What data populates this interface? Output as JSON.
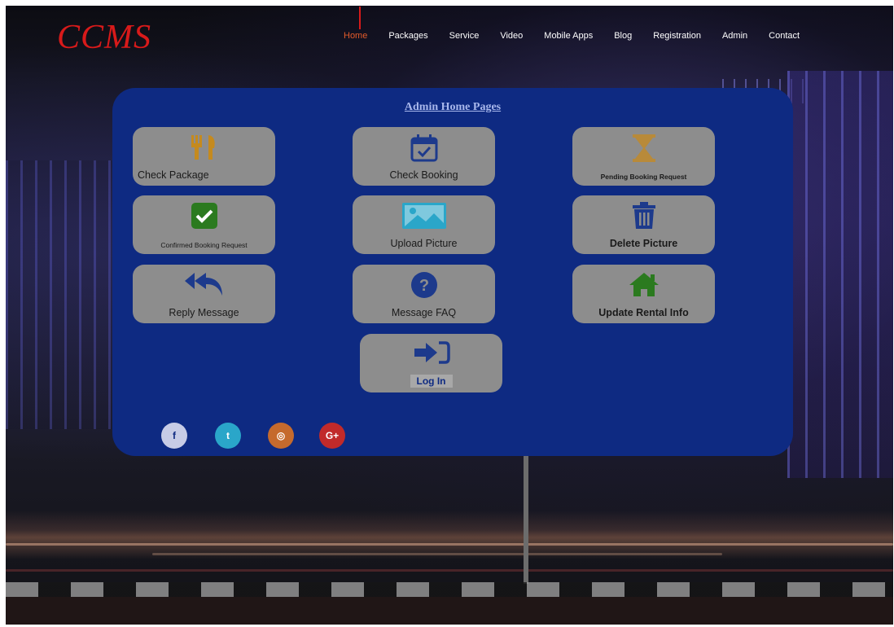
{
  "header": {
    "logo": "CCMS",
    "nav": [
      "Home",
      "Packages",
      "Service",
      "Video",
      "Mobile Apps",
      "Blog",
      "Registration",
      "Admin",
      "Contact"
    ],
    "active": "Home"
  },
  "panel": {
    "title": "Admin Home Pages",
    "cards": [
      {
        "label": "Check Package",
        "icon": "utensils-icon"
      },
      {
        "label": "Check Booking",
        "icon": "calendar-check-icon"
      },
      {
        "label": "Pending Booking Request",
        "icon": "hourglass-icon"
      },
      {
        "label": "Confirmed Booking Request",
        "icon": "check-square-icon"
      },
      {
        "label": "Upload Picture",
        "icon": "image-icon"
      },
      {
        "label": "Delete Picture",
        "icon": "trash-icon"
      },
      {
        "label": "Reply Message",
        "icon": "reply-all-icon"
      },
      {
        "label": "Message FAQ",
        "icon": "question-circle-icon"
      },
      {
        "label": "Update Rental Info",
        "icon": "home-icon"
      },
      {
        "label": "Log In",
        "icon": "sign-in-icon"
      }
    ],
    "social": [
      {
        "name": "facebook-icon",
        "glyph": "f",
        "color": "#c7cce6"
      },
      {
        "name": "twitter-icon",
        "glyph": "t",
        "color": "#2aa6c9"
      },
      {
        "name": "instagram-icon",
        "glyph": "◎",
        "color": "#c56a2d"
      },
      {
        "name": "google-plus-icon",
        "glyph": "G+",
        "color": "#c12a2a"
      }
    ]
  },
  "colors": {
    "accent": "#d81a1a",
    "panel": "#0e2a82",
    "card": "#8d8d8d",
    "utensils": "#c58a1e",
    "calendar": "#1d3a8c",
    "hourglass": "#b88a3a",
    "check": "#2b7a1f",
    "image": "#2aa6c9",
    "trash": "#1d3a8c",
    "reply": "#1d3a8c",
    "question": "#1d3a8c",
    "home": "#2b7a1f",
    "signin": "#1d3a8c"
  }
}
